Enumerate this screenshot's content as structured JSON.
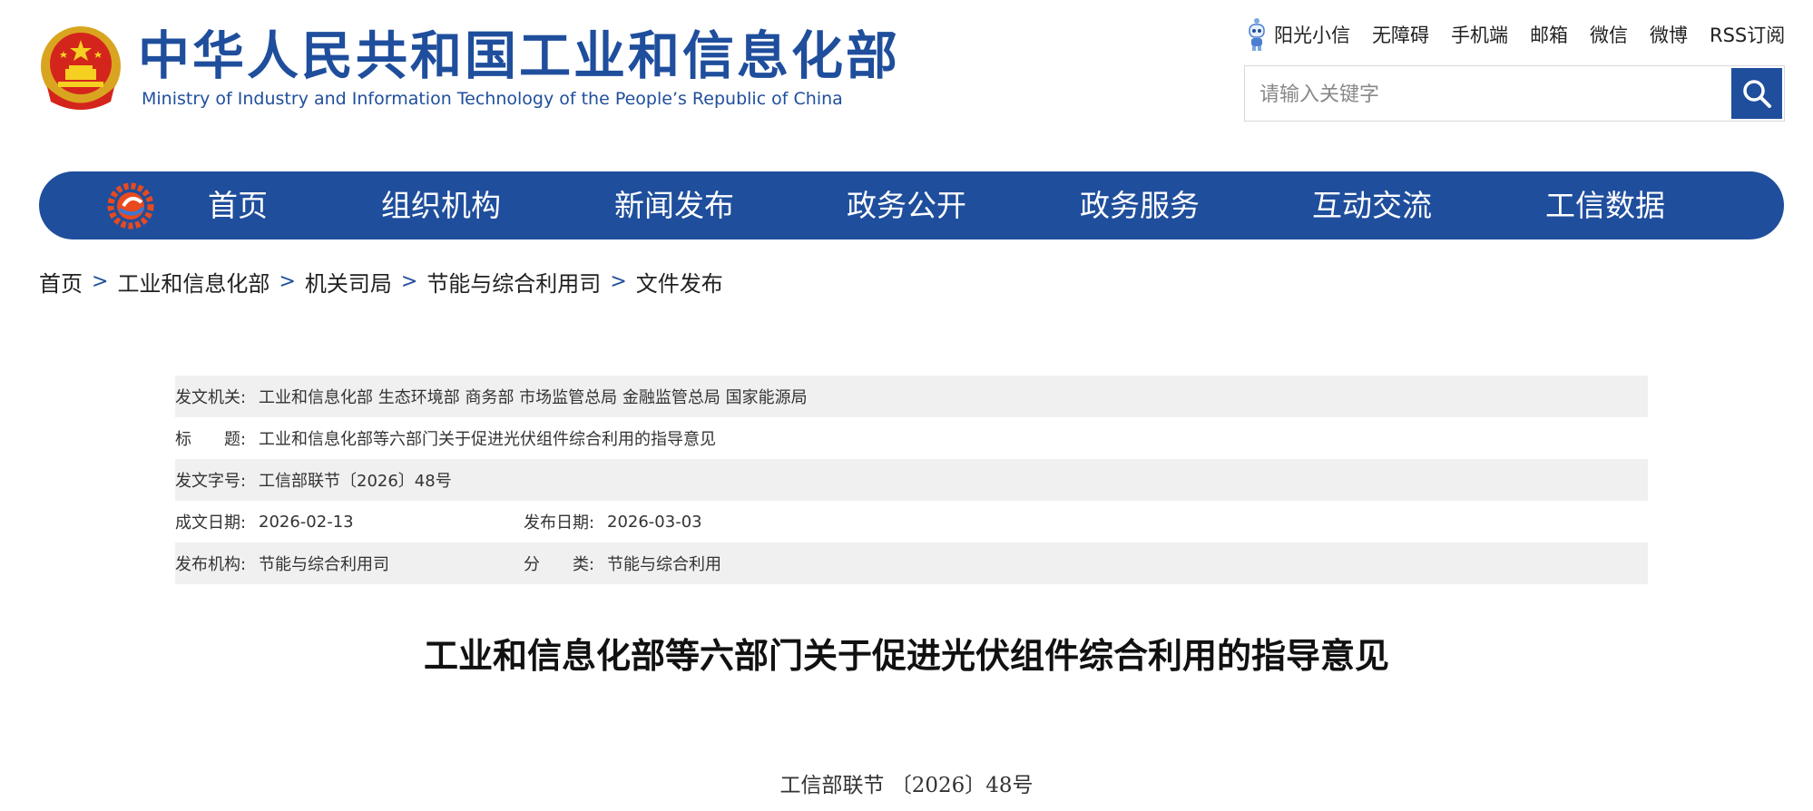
{
  "header": {
    "site_name_cn": "中华人民共和国工业和信息化部",
    "site_name_en": "Ministry of Industry and Information Technology of the People’s Republic of China",
    "emblem_icon": "national-emblem-icon",
    "top_links": [
      "阳光小信",
      "无障碍",
      "手机端",
      "邮箱",
      "微信",
      "微博",
      "RSS订阅"
    ],
    "search": {
      "placeholder": "请输入关键字",
      "value": ""
    },
    "brand_color": "#1f4e9c"
  },
  "nav": {
    "logo_icon": "miit-gear-logo-icon",
    "items": [
      "首页",
      "组织机构",
      "新闻发布",
      "政务公开",
      "政务服务",
      "互动交流",
      "工信数据"
    ]
  },
  "breadcrumb": {
    "items": [
      "首页",
      "工业和信息化部",
      "机关司局",
      "节能与综合利用司",
      "文件发布"
    ],
    "separator": ">"
  },
  "meta": {
    "issuer_label": "发文机关:",
    "issuer_value": "工业和信息化部 生态环境部 商务部 市场监管总局 金融监管总局 国家能源局",
    "title_label": "标　　题:",
    "title_value": "工业和信息化部等六部门关于促进光伏组件综合利用的指导意见",
    "docno_label": "发文字号:",
    "docno_value": "工信部联节〔2026〕48号",
    "written_label": "成文日期:",
    "written_value": "2026-02-13",
    "published_label": "发布日期:",
    "published_value": "2026-03-03",
    "org_label": "发布机构:",
    "org_value": "节能与综合利用司",
    "category_label": "分　　类:",
    "category_value": "节能与综合利用"
  },
  "article": {
    "title": "工业和信息化部等六部门关于促进光伏组件综合利用的指导意见",
    "doc_number": "工信部联节 〔2026〕48号"
  }
}
